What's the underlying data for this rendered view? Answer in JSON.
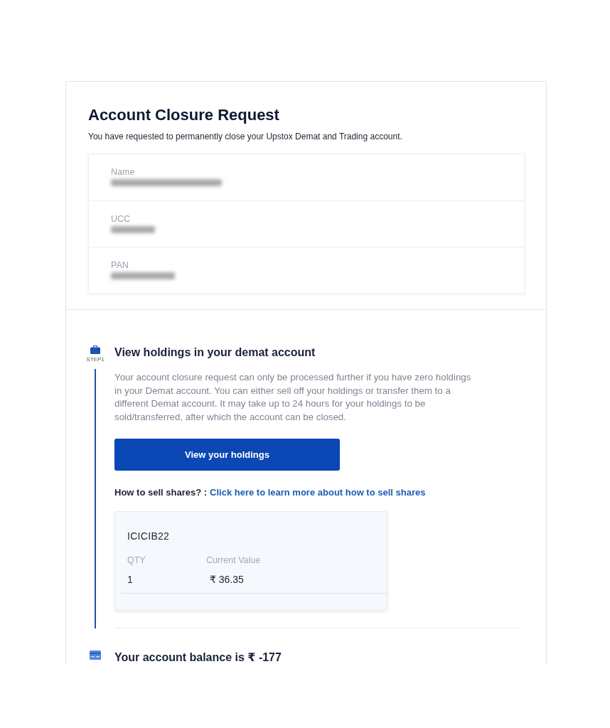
{
  "header": {
    "title": "Account Closure Request",
    "subtitle": "You have requested to permanently close your Upstox Demat and Trading account."
  },
  "details": [
    {
      "label": "Name",
      "redacted": true
    },
    {
      "label": "UCC",
      "redacted": true
    },
    {
      "label": "PAN",
      "redacted": true
    }
  ],
  "steps": [
    {
      "kind": "holdings",
      "step_label": "STEP1",
      "title": "View holdings in your demat account",
      "description": "Your account closure request can only be processed further if you have zero holdings in your Demat account. You can either sell off your holdings or transfer them to a different Demat account. It may take up to 24 hours for your holdings to be sold/transferred, after which the account can be closed.",
      "button": "View your holdings",
      "help_prompt": "How to sell shares? :",
      "help_link": "Click here to learn more about how to sell shares",
      "holdings": [
        {
          "symbol": "ICICIB22",
          "qty_label": "QTY",
          "qty": "1",
          "value_label": "Current Value",
          "value": "₹ 36.35"
        }
      ]
    },
    {
      "kind": "balance",
      "title": "Your account balance is ₹ -177"
    }
  ]
}
